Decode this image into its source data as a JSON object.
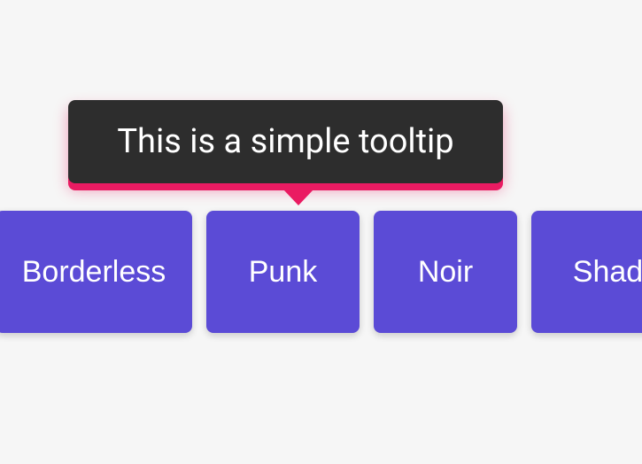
{
  "tooltip": {
    "text": "This is a simple tooltip"
  },
  "buttons": {
    "borderless": "Borderless",
    "punk": "Punk",
    "noir": "Noir",
    "shade": "Shad"
  },
  "colors": {
    "button_bg": "#5b4bd6",
    "tooltip_bg": "#2d2d2d",
    "tooltip_accent": "#ea1b62",
    "page_bg": "#f6f6f6"
  }
}
